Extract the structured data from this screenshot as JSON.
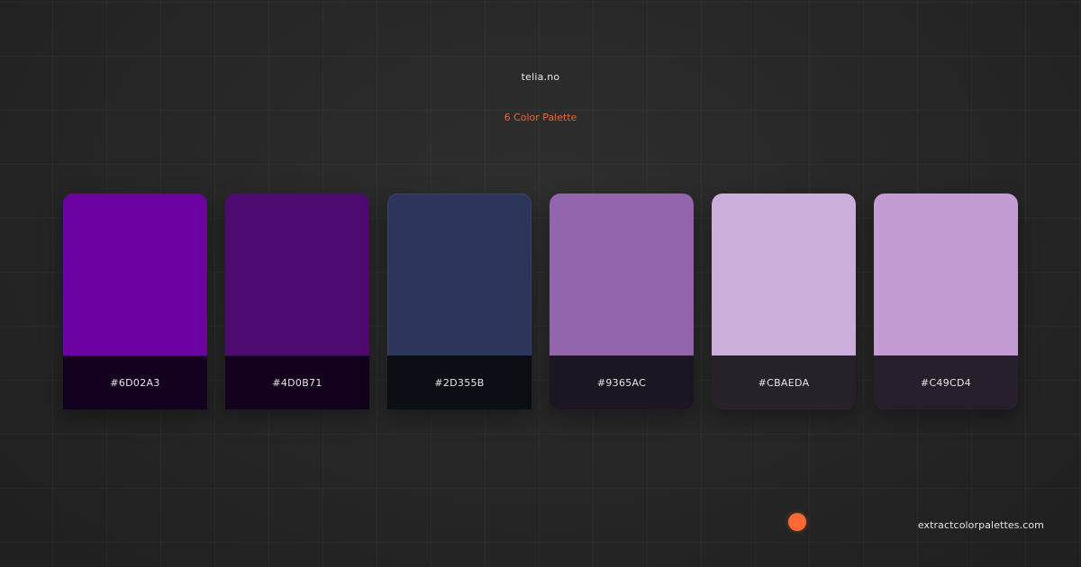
{
  "header": {
    "site": "telia.no",
    "palette_title": "6 Color Palette"
  },
  "swatches": [
    {
      "hex": "#6D02A3"
    },
    {
      "hex": "#4D0B71"
    },
    {
      "hex": "#2D355B"
    },
    {
      "hex": "#9365AC"
    },
    {
      "hex": "#CBAEDA"
    },
    {
      "hex": "#C49CD4"
    }
  ],
  "footer": {
    "brand": "extractcolorpalettes.com",
    "accent_color": "#FF6A33"
  }
}
